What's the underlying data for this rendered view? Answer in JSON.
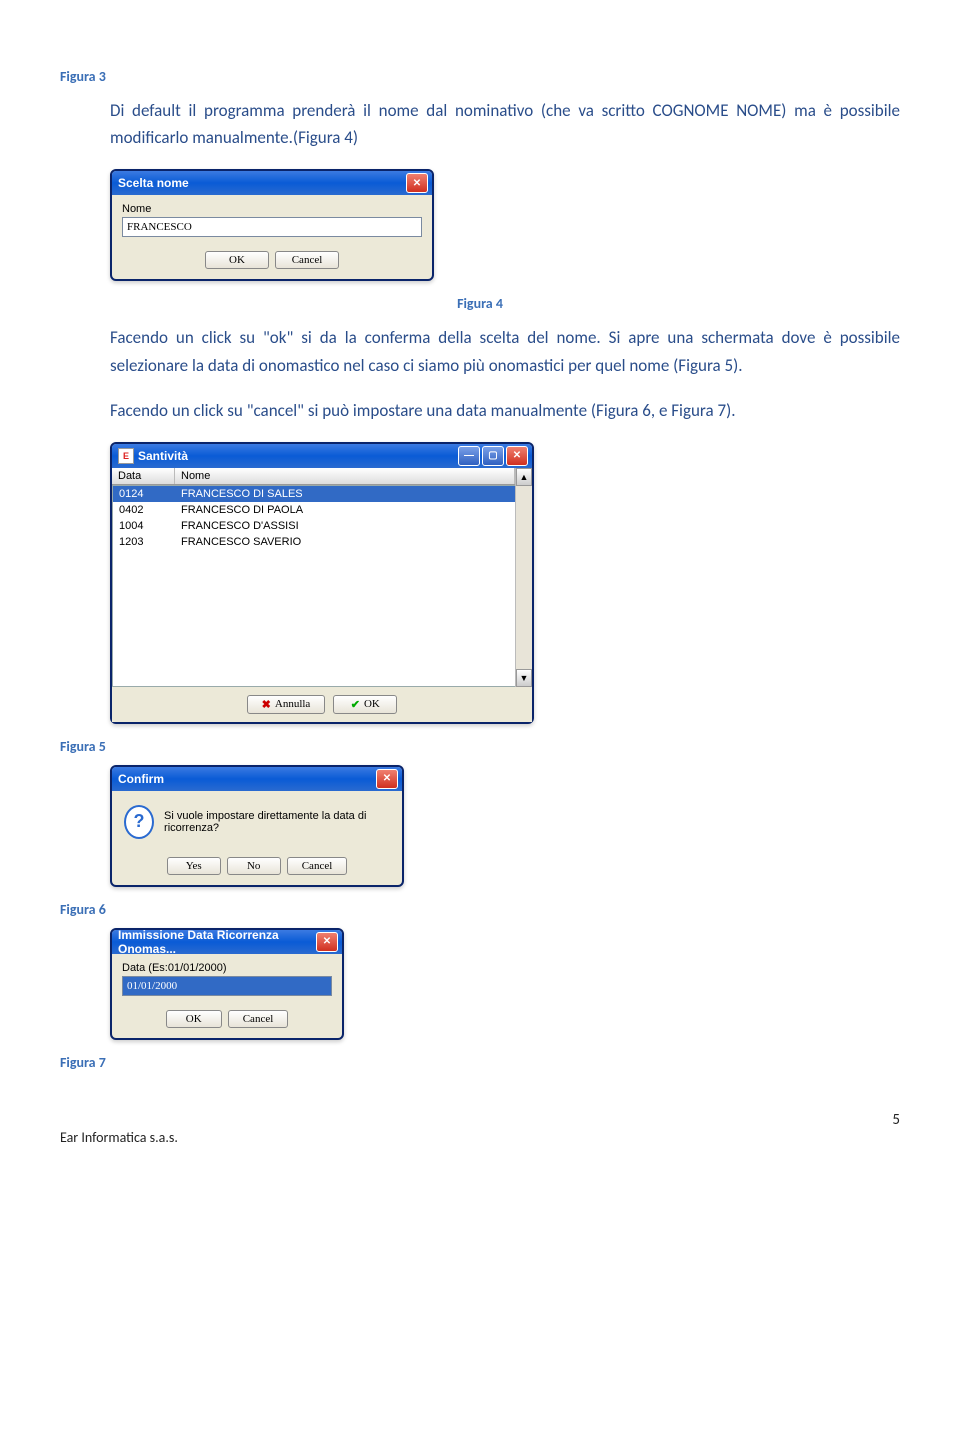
{
  "captions": {
    "fig3": "Figura 3",
    "fig4": "Figura 4",
    "fig5": "Figura 5",
    "fig6": "Figura 6",
    "fig7": "Figura 7"
  },
  "paragraphs": {
    "p1": "Di default il programma prenderà il nome dal nominativo (che va scritto COGNOME NOME) ma è possibile modificarlo manualmente.(Figura 4)",
    "p2": "Facendo un click su \"ok\" si da la conferma della scelta del nome. Si apre una schermata dove è possibile selezionare la data di onomastico nel caso ci siamo più onomastici per quel nome (Figura 5).",
    "p3": "Facendo un click su \"cancel\" si può impostare una data manualmente (Figura 6, e Figura 7)."
  },
  "dlg_scelta_nome": {
    "title": "Scelta nome",
    "label_nome": "Nome",
    "input_value": "FRANCESCO",
    "ok": "OK",
    "cancel": "Cancel"
  },
  "dlg_santivita": {
    "title": "Santività",
    "col_data": "Data",
    "col_nome": "Nome",
    "rows": [
      {
        "data": "0124",
        "nome": "FRANCESCO DI SALES"
      },
      {
        "data": "0402",
        "nome": "FRANCESCO DI PAOLA"
      },
      {
        "data": "1004",
        "nome": "FRANCESCO D'ASSISI"
      },
      {
        "data": "1203",
        "nome": "FRANCESCO SAVERIO"
      }
    ],
    "annulla": "Annulla",
    "ok": "OK"
  },
  "dlg_confirm": {
    "title": "Confirm",
    "message": "Si vuole impostare direttamente la data di ricorrenza?",
    "yes": "Yes",
    "no": "No",
    "cancel": "Cancel"
  },
  "dlg_immissione": {
    "title": "Immissione Data Ricorrenza Onomas...",
    "label": "Data (Es:01/01/2000)",
    "value": "01/01/2000",
    "ok": "OK",
    "cancel": "Cancel"
  },
  "footer": "Ear Informatica s.a.s.",
  "page_number": "5"
}
